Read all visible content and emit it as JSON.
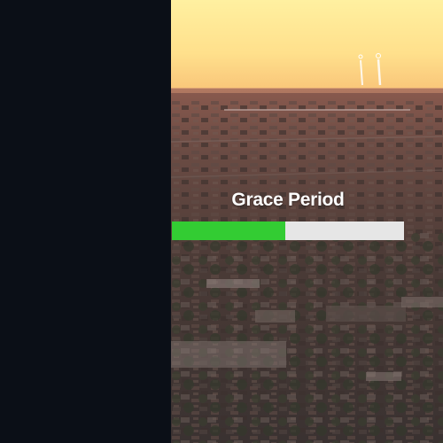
{
  "hud": {
    "title": "Grace Period",
    "progress": 0.49,
    "progress_color": "#33cc33",
    "track_color": "#e6e6e6"
  },
  "scene": {
    "description_icon": "aerial-city-sunset"
  },
  "colors": {
    "left_panel": "#0b0f17",
    "sky_top": "#ffe58a",
    "sky_horizon": "#f7c97a"
  }
}
